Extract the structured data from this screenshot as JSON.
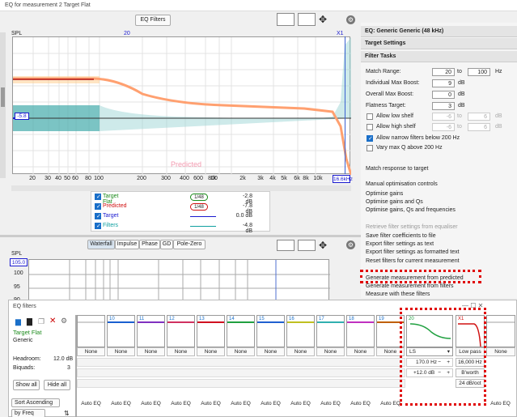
{
  "window": {
    "title": "EQ for measurement 2 Target Flat"
  },
  "toolbar": {
    "eq_filters": "EQ Filters"
  },
  "plot": {
    "spl_label": "SPL",
    "marker_20": "20",
    "marker_x1": "X1",
    "readout_left": "-5.8",
    "readout_right": "16.6kHz",
    "predicted_label": "Predicted",
    "x_ticks": [
      "20",
      "30",
      "40",
      "50",
      "60",
      "80",
      "100",
      "200",
      "300",
      "400",
      "600",
      "800",
      "1k",
      "2k",
      "3k",
      "4k",
      "5k",
      "6k",
      "8k",
      "10k"
    ]
  },
  "legend": [
    {
      "label": "Target Flat",
      "val": "-2.8 dB",
      "color": "#1a8a1a",
      "box": "1/48"
    },
    {
      "label": "Predicted",
      "val": "-7.8 dB",
      "color": "#d01010",
      "box": "1/48"
    },
    {
      "label": "Target",
      "val": "0.0 dB",
      "color": "#1a1ad0",
      "box": ""
    },
    {
      "label": "Filters",
      "val": "-4.8 dB",
      "color": "#10a0a0",
      "box": ""
    }
  ],
  "tabs2": [
    "Waterfall",
    "Impulse",
    "Phase",
    "GD",
    "Pole-Zero"
  ],
  "plot2": {
    "spl": "SPL",
    "top_val": "105.0",
    "y_ticks": [
      "100",
      "95",
      "90"
    ]
  },
  "right_panel": {
    "eq_header": "EQ: Generic Generic (48 kHz)",
    "target_settings": "Target Settings",
    "filter_tasks": "Filter Tasks",
    "match_range": "Match Range:",
    "mr_from": "20",
    "mr_to_label": "to",
    "mr_to": "100",
    "mr_unit": "Hz",
    "indiv_boost": "Individual Max Boost:",
    "indiv_val": "9",
    "indiv_unit": "dB",
    "overall_boost": "Overall Max Boost:",
    "overall_val": "0",
    "overall_unit": "dB",
    "flatness": "Flatness Target:",
    "flat_val": "3",
    "flat_unit": "dB",
    "low_shelf": "Allow low shelf",
    "ls_a": "-6",
    "ls_to": "to",
    "ls_b": "6",
    "ls_unit": "dB",
    "high_shelf": "Allow high shelf",
    "hs_a": "-6",
    "hs_to": "to",
    "hs_b": "6",
    "hs_unit": "dB",
    "narrow": "Allow narrow filters below 200 Hz",
    "vary_q": "Vary max Q above 200 Hz",
    "match_response": "Match response to target",
    "manual_opt": "Manual optimisation controls",
    "opt_gains": "Optimise gains",
    "opt_gains_qs": "Optimise gains and Qs",
    "opt_gains_qs_freq": "Optimise gains, Qs and frequencies",
    "retrieve": "Retrieve filter settings from equaliser",
    "save_coeff": "Save filter coefficients to file",
    "export_text": "Export filter settings as text",
    "export_fmt": "Export filter settings as formatted text",
    "reset": "Reset filters for current measurement",
    "gen_predicted": "Generate measurement from predicted",
    "gen_filters": "Generate measurement from filters",
    "measure_with": "Measure with these filters"
  },
  "eq_window": {
    "title": "EQ filters",
    "target_name": "Target Flat",
    "eq_name": "Generic",
    "headroom_label": "Headroom:",
    "headroom_val": "12.0 dB",
    "biquads_label": "Biquads:",
    "biquads_val": "3",
    "show_all": "Show all",
    "hide_all": "Hide all",
    "sort": "Sort Ascending",
    "by": "by Freq",
    "filters": [
      {
        "n": "",
        "color": "#d0d0d0"
      },
      {
        "n": "10",
        "color": "#1a5fd0"
      },
      {
        "n": "11",
        "color": "#8030c0"
      },
      {
        "n": "12",
        "color": "#d03060"
      },
      {
        "n": "13",
        "color": "#d01020"
      },
      {
        "n": "14",
        "color": "#20a040"
      },
      {
        "n": "15",
        "color": "#2060d0"
      },
      {
        "n": "16",
        "color": "#c0c020"
      },
      {
        "n": "17",
        "color": "#30b0b0"
      },
      {
        "n": "18",
        "color": "#c030c0"
      },
      {
        "n": "19",
        "color": "#c06000"
      }
    ],
    "none_label": "None",
    "auto_eq": "Auto EQ",
    "ls_filter": {
      "n": "20",
      "type": "LS",
      "freq": "170.0 Hz",
      "gain": "+12.0 dB"
    },
    "lp_filter": {
      "n": "X1",
      "type": "Low pass",
      "freq": "16,000 Hz",
      "mode": "B'worth",
      "slope": "24 dB/oct"
    }
  }
}
